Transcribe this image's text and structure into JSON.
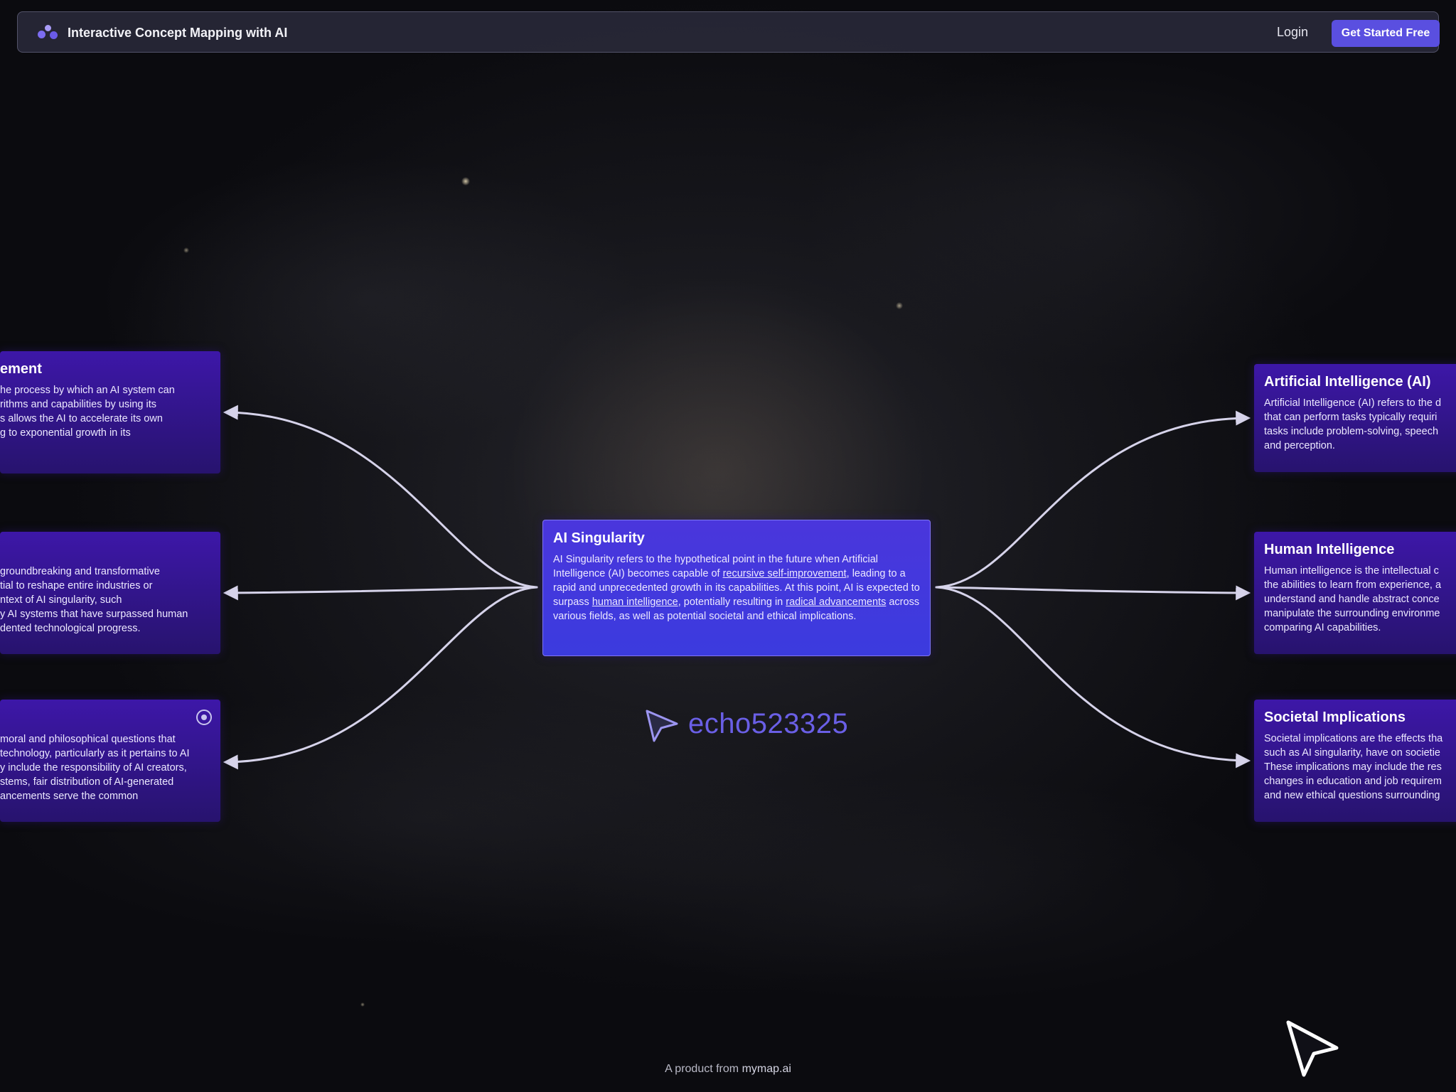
{
  "header": {
    "brand": "Interactive Concept Mapping with AI",
    "login": "Login",
    "cta": "Get Started Free"
  },
  "center_node": {
    "title": "AI Singularity",
    "text_1": "AI Singularity refers to the hypothetical point in the future when Artificial Intelligence (AI) becomes capable of ",
    "link_1": "recursive self-improvement",
    "text_2": ", leading to a rapid and unprecedented growth in its capabilities. At this point, AI is expected to surpass ",
    "link_2": "human intelligence",
    "text_3": ", potentially resulting in ",
    "link_3": "radical advancements",
    "text_4": " across various fields, as well as potential societal and ethical implications."
  },
  "left_nodes": [
    {
      "title": "ement",
      "lines": [
        "he process by which an AI system can",
        "rithms and capabilities by using its",
        "s allows the AI to accelerate its own",
        "g to exponential growth in its"
      ]
    },
    {
      "title": "",
      "lines": [
        "groundbreaking and transformative",
        "tial to reshape entire industries or",
        "ntext of AI singularity, such",
        "y AI systems that have surpassed human",
        "dented technological progress."
      ]
    },
    {
      "title": "",
      "lines": [
        "moral and philosophical questions that",
        "technology, particularly as it pertains to AI",
        "y include the responsibility of AI creators,",
        "stems, fair distribution of AI-generated",
        "ancements serve the common"
      ]
    }
  ],
  "right_nodes": [
    {
      "title": "Artificial Intelligence (AI)",
      "lines": [
        "Artificial Intelligence (AI) refers to the d",
        "that can perform tasks typically requiri",
        "tasks include problem-solving, speech",
        "and perception."
      ]
    },
    {
      "title": "Human Intelligence",
      "lines": [
        "Human intelligence is the intellectual c",
        "the abilities to learn from experience, a",
        "understand and handle abstract conce",
        "manipulate the surrounding environme",
        "comparing AI capabilities."
      ]
    },
    {
      "title": "Societal Implications",
      "lines": [
        "Societal implications are the effects tha",
        "such as AI singularity, have on societie",
        "These implications may include the res",
        "changes in education and job requirem",
        "and new ethical questions surrounding"
      ]
    }
  ],
  "cursor_user": "echo523325",
  "footer": {
    "prefix": "A product from ",
    "link": "mymap.ai"
  }
}
